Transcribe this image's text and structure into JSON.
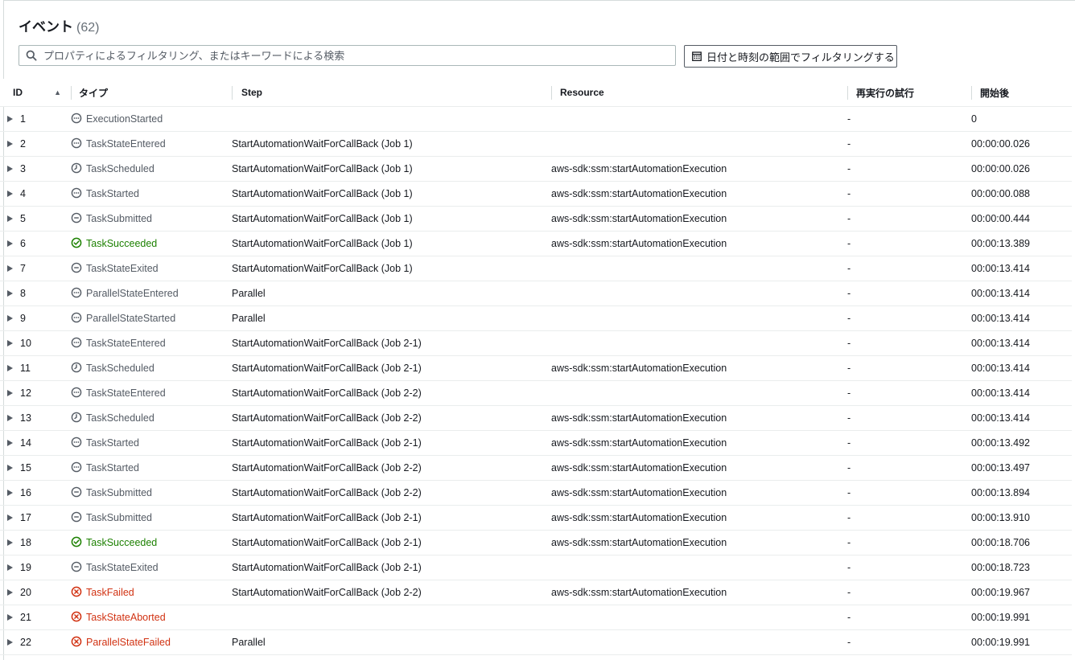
{
  "header": {
    "title": "イベント",
    "count": "(62)"
  },
  "search": {
    "placeholder": "プロパティによるフィルタリング、またはキーワードによる検索"
  },
  "date_filter": {
    "label": "日付と時刻の範囲でフィルタリングする"
  },
  "columns": {
    "id": "ID",
    "type": "タイプ",
    "step": "Step",
    "resource": "Resource",
    "retry": "再実行の試行",
    "start": "開始後"
  },
  "colors": {
    "normal": "#545b64",
    "success": "#1d8102",
    "fail": "#d13212"
  },
  "rows": [
    {
      "id": "1",
      "type": "ExecutionStarted",
      "status": "normal",
      "icon": "ellipsis-circle-icon",
      "step": "",
      "resource": "",
      "retry": "-",
      "start": "0"
    },
    {
      "id": "2",
      "type": "TaskStateEntered",
      "status": "normal",
      "icon": "ellipsis-circle-icon",
      "step": "StartAutomationWaitForCallBack (Job 1)",
      "resource": "",
      "retry": "-",
      "start": "00:00:00.026"
    },
    {
      "id": "3",
      "type": "TaskScheduled",
      "status": "normal",
      "icon": "clock-icon",
      "step": "StartAutomationWaitForCallBack (Job 1)",
      "resource": "aws-sdk:ssm:startAutomationExecution",
      "retry": "-",
      "start": "00:00:00.026"
    },
    {
      "id": "4",
      "type": "TaskStarted",
      "status": "normal",
      "icon": "ellipsis-circle-icon",
      "step": "StartAutomationWaitForCallBack (Job 1)",
      "resource": "aws-sdk:ssm:startAutomationExecution",
      "retry": "-",
      "start": "00:00:00.088"
    },
    {
      "id": "5",
      "type": "TaskSubmitted",
      "status": "normal",
      "icon": "minus-circle-icon",
      "step": "StartAutomationWaitForCallBack (Job 1)",
      "resource": "aws-sdk:ssm:startAutomationExecution",
      "retry": "-",
      "start": "00:00:00.444"
    },
    {
      "id": "6",
      "type": "TaskSucceeded",
      "status": "success",
      "icon": "check-circle-icon",
      "step": "StartAutomationWaitForCallBack (Job 1)",
      "resource": "aws-sdk:ssm:startAutomationExecution",
      "retry": "-",
      "start": "00:00:13.389"
    },
    {
      "id": "7",
      "type": "TaskStateExited",
      "status": "normal",
      "icon": "minus-circle-icon",
      "step": "StartAutomationWaitForCallBack (Job 1)",
      "resource": "",
      "retry": "-",
      "start": "00:00:13.414"
    },
    {
      "id": "8",
      "type": "ParallelStateEntered",
      "status": "normal",
      "icon": "ellipsis-circle-icon",
      "step": "Parallel",
      "resource": "",
      "retry": "-",
      "start": "00:00:13.414"
    },
    {
      "id": "9",
      "type": "ParallelStateStarted",
      "status": "normal",
      "icon": "ellipsis-circle-icon",
      "step": "Parallel",
      "resource": "",
      "retry": "-",
      "start": "00:00:13.414"
    },
    {
      "id": "10",
      "type": "TaskStateEntered",
      "status": "normal",
      "icon": "ellipsis-circle-icon",
      "step": "StartAutomationWaitForCallBack (Job 2-1)",
      "resource": "",
      "retry": "-",
      "start": "00:00:13.414"
    },
    {
      "id": "11",
      "type": "TaskScheduled",
      "status": "normal",
      "icon": "clock-icon",
      "step": "StartAutomationWaitForCallBack (Job 2-1)",
      "resource": "aws-sdk:ssm:startAutomationExecution",
      "retry": "-",
      "start": "00:00:13.414"
    },
    {
      "id": "12",
      "type": "TaskStateEntered",
      "status": "normal",
      "icon": "ellipsis-circle-icon",
      "step": "StartAutomationWaitForCallBack (Job 2-2)",
      "resource": "",
      "retry": "-",
      "start": "00:00:13.414"
    },
    {
      "id": "13",
      "type": "TaskScheduled",
      "status": "normal",
      "icon": "clock-icon",
      "step": "StartAutomationWaitForCallBack (Job 2-2)",
      "resource": "aws-sdk:ssm:startAutomationExecution",
      "retry": "-",
      "start": "00:00:13.414"
    },
    {
      "id": "14",
      "type": "TaskStarted",
      "status": "normal",
      "icon": "ellipsis-circle-icon",
      "step": "StartAutomationWaitForCallBack (Job 2-1)",
      "resource": "aws-sdk:ssm:startAutomationExecution",
      "retry": "-",
      "start": "00:00:13.492"
    },
    {
      "id": "15",
      "type": "TaskStarted",
      "status": "normal",
      "icon": "ellipsis-circle-icon",
      "step": "StartAutomationWaitForCallBack (Job 2-2)",
      "resource": "aws-sdk:ssm:startAutomationExecution",
      "retry": "-",
      "start": "00:00:13.497"
    },
    {
      "id": "16",
      "type": "TaskSubmitted",
      "status": "normal",
      "icon": "minus-circle-icon",
      "step": "StartAutomationWaitForCallBack (Job 2-2)",
      "resource": "aws-sdk:ssm:startAutomationExecution",
      "retry": "-",
      "start": "00:00:13.894"
    },
    {
      "id": "17",
      "type": "TaskSubmitted",
      "status": "normal",
      "icon": "minus-circle-icon",
      "step": "StartAutomationWaitForCallBack (Job 2-1)",
      "resource": "aws-sdk:ssm:startAutomationExecution",
      "retry": "-",
      "start": "00:00:13.910"
    },
    {
      "id": "18",
      "type": "TaskSucceeded",
      "status": "success",
      "icon": "check-circle-icon",
      "step": "StartAutomationWaitForCallBack (Job 2-1)",
      "resource": "aws-sdk:ssm:startAutomationExecution",
      "retry": "-",
      "start": "00:00:18.706"
    },
    {
      "id": "19",
      "type": "TaskStateExited",
      "status": "normal",
      "icon": "minus-circle-icon",
      "step": "StartAutomationWaitForCallBack (Job 2-1)",
      "resource": "",
      "retry": "-",
      "start": "00:00:18.723"
    },
    {
      "id": "20",
      "type": "TaskFailed",
      "status": "fail",
      "icon": "x-circle-icon",
      "step": "StartAutomationWaitForCallBack (Job 2-2)",
      "resource": "aws-sdk:ssm:startAutomationExecution",
      "retry": "-",
      "start": "00:00:19.967"
    },
    {
      "id": "21",
      "type": "TaskStateAborted",
      "status": "fail",
      "icon": "x-circle-icon",
      "step": "",
      "resource": "",
      "retry": "-",
      "start": "00:00:19.991"
    },
    {
      "id": "22",
      "type": "ParallelStateFailed",
      "status": "fail",
      "icon": "x-circle-icon",
      "step": "Parallel",
      "resource": "",
      "retry": "-",
      "start": "00:00:19.991"
    }
  ]
}
